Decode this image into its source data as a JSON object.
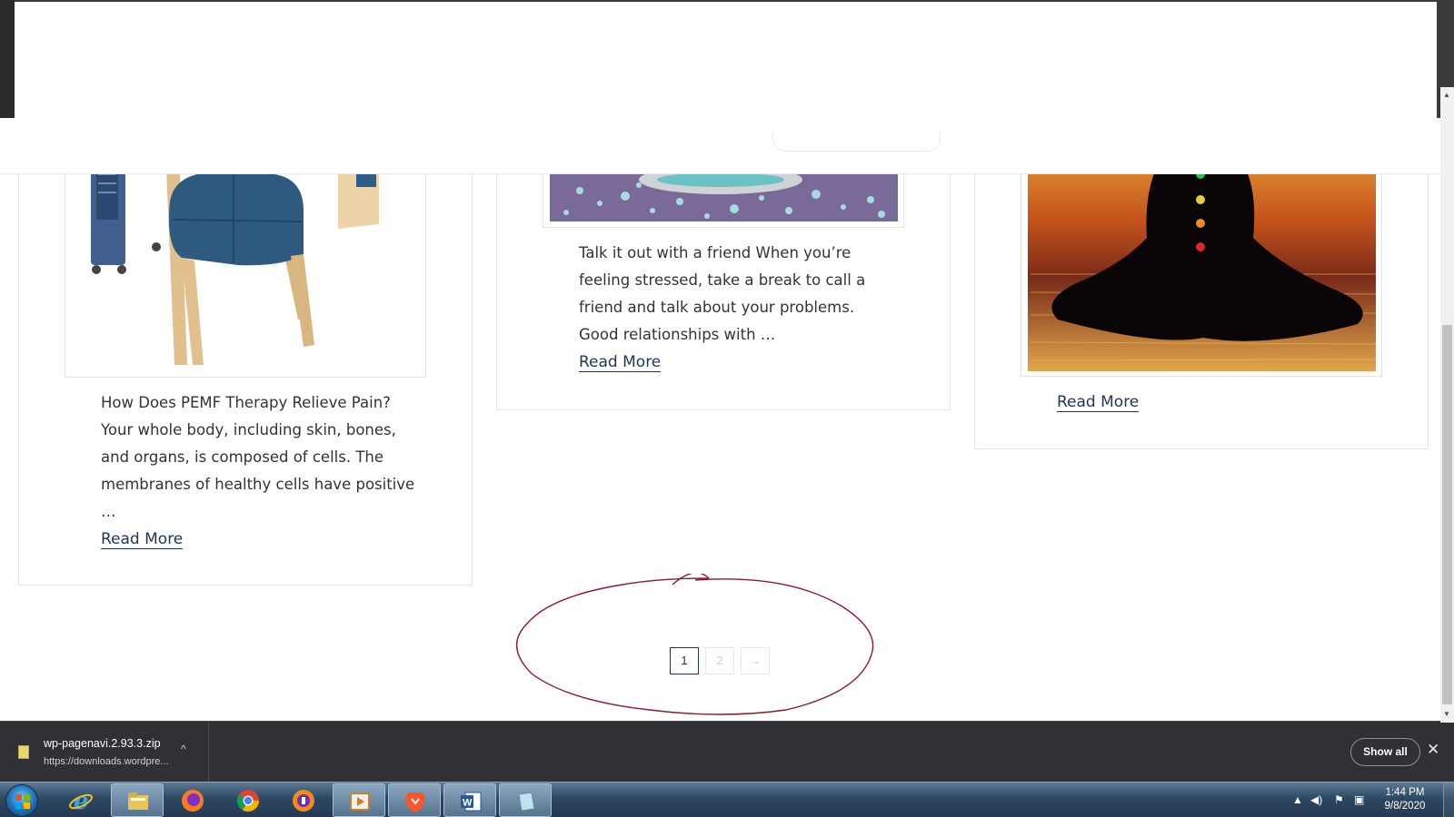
{
  "posts": [
    {
      "excerpt_lines": [
        "How Does PEMF Therapy Relieve Pain?",
        "Your whole body, including skin, bones,",
        "and organs, is composed of cells. The",
        "membranes of healthy cells have positive",
        "…"
      ],
      "read_more": "Read More",
      "image_icon": "pemf-chair-image"
    },
    {
      "excerpt_lines": [
        "Talk it out with a friend When you’re",
        "feeling stressed, take a break to call a",
        "friend and talk about your problems.",
        "Good relationships with …"
      ],
      "read_more": "Read More",
      "image_icon": "bath-salts-image"
    },
    {
      "excerpt_lines": [],
      "read_more": "Read More",
      "image_icon": "meditation-chakra-image"
    }
  ],
  "pagination": {
    "pages": [
      "1",
      "2"
    ],
    "current": "1",
    "next": "→"
  },
  "download_bar": {
    "file_name": "wp-pagenavi.2.93.3.zip",
    "url": "https://downloads.wordpre...",
    "show_all": "Show all",
    "close": "✕",
    "caret": "^"
  },
  "taskbar": {
    "time": "1:44 PM",
    "date": "9/8/2020",
    "pinned": [
      "internet-explorer-icon",
      "file-explorer-icon",
      "firefox-icon",
      "chrome-icon",
      "vpn-browser-icon",
      "media-player-icon",
      "brave-icon",
      "word-icon",
      "notepad-icon"
    ]
  },
  "colors": {
    "link": "#1d3557",
    "annotation": "#8b1a2b",
    "download_bar": "#2f3136"
  }
}
